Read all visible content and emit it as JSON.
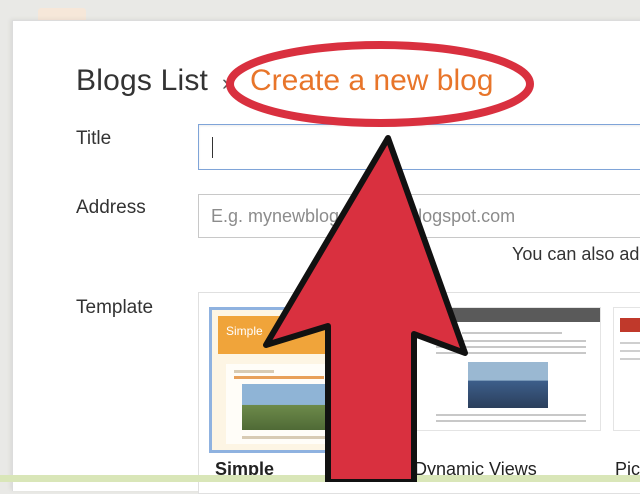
{
  "breadcrumb": {
    "root": "Blogs List",
    "separator": "›",
    "current": "Create a new blog"
  },
  "form": {
    "title_label": "Title",
    "title_value": "",
    "address_label": "Address",
    "address_placeholder": "E.g. mynewblogaddress.blogspot.com",
    "address_hint": "You can also ad",
    "template_label": "Template"
  },
  "templates": [
    {
      "name": "Simple",
      "thumb_title": "Simple",
      "selected": true
    },
    {
      "name": "Dynamic Views",
      "selected": false
    },
    {
      "name": "Pic",
      "selected": false
    }
  ],
  "annotation": {
    "ellipse_color": "#d9303f",
    "arrow_color": "#d9303f",
    "outline_color": "#111111"
  },
  "colors": {
    "accent_orange": "#e8752a",
    "field_focus_border": "#7fa4d8",
    "selected_template_border": "#8fb2e0"
  }
}
